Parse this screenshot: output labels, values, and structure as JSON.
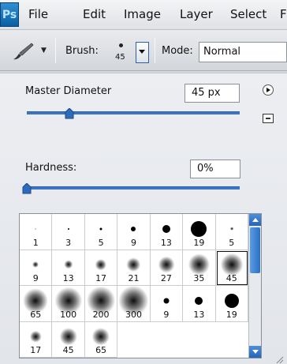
{
  "app": {
    "logo": "Ps"
  },
  "menu": [
    "File",
    "Edit",
    "Image",
    "Layer",
    "Select",
    "F"
  ],
  "options": {
    "tool_icon": "brush-tool-icon",
    "brush_label": "Brush:",
    "brush_size": "45",
    "mode_label": "Mode:",
    "mode_value": "Normal"
  },
  "panel": {
    "master_diameter_label": "Master Diameter",
    "master_diameter_value": "45 px",
    "master_diameter_fraction": 0.2,
    "hardness_label": "Hardness:",
    "hardness_value": "0%",
    "hardness_fraction": 0.0
  },
  "brushes": [
    {
      "label": "1",
      "type": "hard",
      "d": 1
    },
    {
      "label": "3",
      "type": "hard",
      "d": 2
    },
    {
      "label": "5",
      "type": "hard",
      "d": 3
    },
    {
      "label": "9",
      "type": "hard",
      "d": 6
    },
    {
      "label": "13",
      "type": "hard",
      "d": 10
    },
    {
      "label": "19",
      "type": "hard",
      "d": 20
    },
    {
      "label": "5",
      "type": "soft",
      "d": 3
    },
    {
      "label": "9",
      "type": "soft",
      "d": 5
    },
    {
      "label": "13",
      "type": "soft",
      "d": 7
    },
    {
      "label": "17",
      "type": "soft",
      "d": 9
    },
    {
      "label": "21",
      "type": "soft",
      "d": 11
    },
    {
      "label": "27",
      "type": "soft",
      "d": 13
    },
    {
      "label": "35",
      "type": "soft",
      "d": 17
    },
    {
      "label": "45",
      "type": "soft",
      "d": 18
    },
    {
      "label": "65",
      "type": "soft",
      "d": 20
    },
    {
      "label": "100",
      "type": "soft",
      "d": 22
    },
    {
      "label": "200",
      "type": "soft",
      "d": 23
    },
    {
      "label": "300",
      "type": "soft",
      "d": 24
    },
    {
      "label": "9",
      "type": "hard",
      "d": 7
    },
    {
      "label": "13",
      "type": "hard",
      "d": 10
    },
    {
      "label": "19",
      "type": "hard",
      "d": 18
    },
    {
      "label": "17",
      "type": "soft",
      "d": 9
    },
    {
      "label": "45",
      "type": "soft",
      "d": 14
    },
    {
      "label": "65",
      "type": "soft",
      "d": 14
    }
  ],
  "selected_brush_index": 13,
  "colors": {
    "accent": "#3a76c4",
    "panel": "#e6e9ed"
  }
}
